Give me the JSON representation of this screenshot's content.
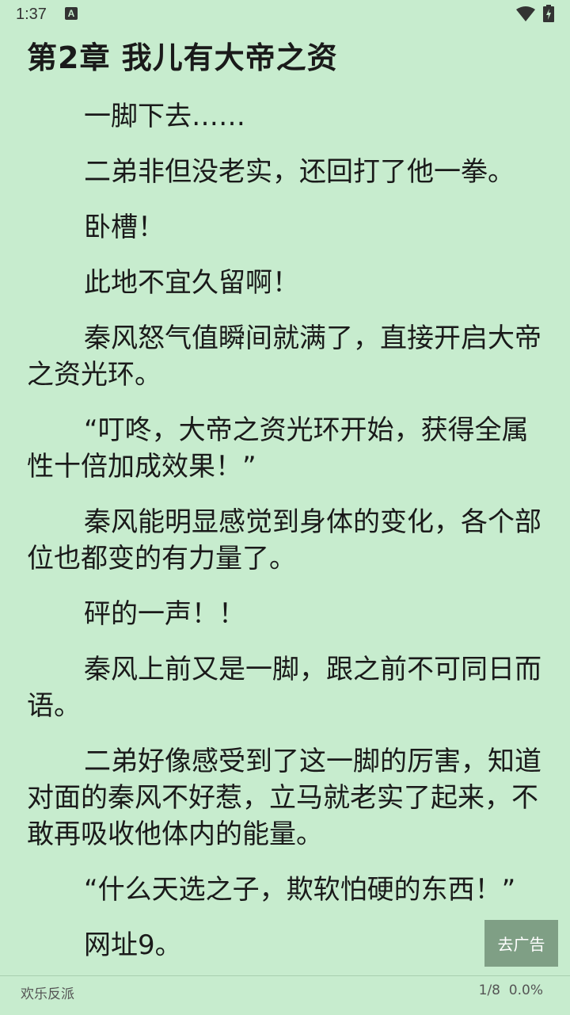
{
  "status_bar": {
    "time": "1:37",
    "notification_glyph": "A"
  },
  "chapter": {
    "title": "第2章 我儿有大帝之资"
  },
  "paragraphs": [
    "一脚下去……",
    "二弟非但没老实，还回打了他一拳。",
    "卧槽！",
    "此地不宜久留啊！",
    "秦风怒气值瞬间就满了，直接开启大帝之资光环。",
    "“叮咚，大帝之资光环开始，获得全属性十倍加成效果！”",
    "秦风能明显感觉到身体的变化，各个部位也都变的有力量了。",
    "砰的一声！！",
    "秦风上前又是一脚，跟之前不可同日而语。",
    "二弟好像感受到了这一脚的厉害，知道对面的秦风不好惹，立马就老实了起来，不敢再吸收他体内的能量。",
    "“什么天选之子，欺软怕硬的东西！”",
    "网址9。"
  ],
  "ad_button": {
    "label": "去广告"
  },
  "footer": {
    "book_name": "欢乐反派",
    "page": "1/8",
    "percent": "0.0%"
  },
  "colors": {
    "background": "#c7ecce",
    "ad_button": "#7f9f85",
    "text": "#1a1a1a"
  },
  "icons": [
    "wifi-icon",
    "battery-icon",
    "notification-icon"
  ]
}
